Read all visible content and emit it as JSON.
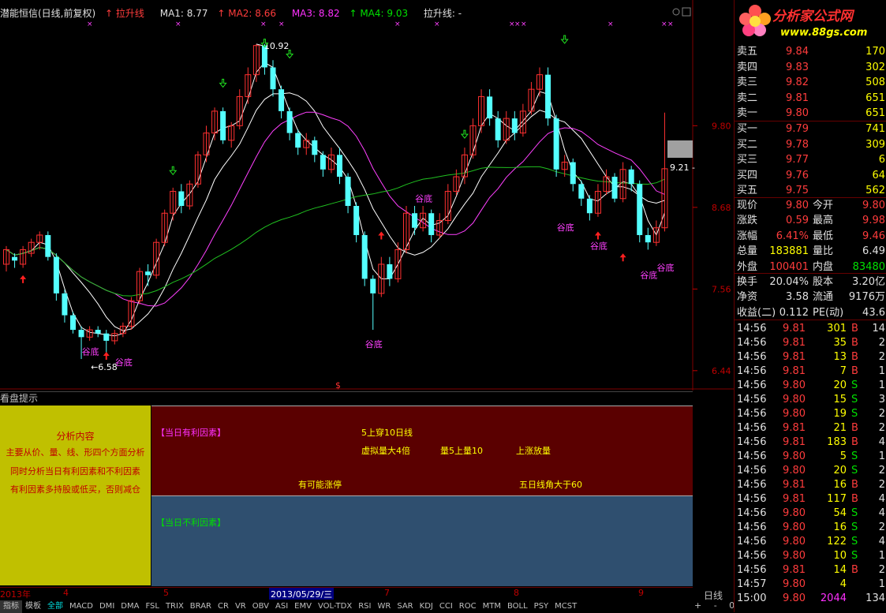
{
  "chart_title": {
    "name": "潜能恒信(日线,前复权)",
    "indicator": "拉升线",
    "ma1": "MA1: 8.77",
    "ma2": "MA2: 8.66",
    "ma3": "MA3: 8.82",
    "ma4": "MA4: 9.03",
    "line": "拉升线: -"
  },
  "price_axis": [
    "9.80",
    "8.68",
    "7.56",
    "6.44"
  ],
  "annotations": {
    "high": "10.92",
    "low": "6.58",
    "last": "9.21",
    "bottom_label": "谷底",
    "s_mark": "$"
  },
  "panel": {
    "title": "看盘提示",
    "left_lines": [
      "分析内容",
      "主要从价、量、线、形四个方面分析",
      "同时分析当日有利因素和不利因素",
      "有利因素多持股或低买，否则减仓"
    ],
    "good_header": "【当日有利因素】",
    "good_items": [
      "5上穿10日线",
      "虚拟量大4倍",
      "量5上量10",
      "上涨放量",
      "有可能涨停",
      "五日线角大于60"
    ],
    "bad_header": "【当日不利因素】"
  },
  "date_axis": {
    "labels": [
      "2013年",
      "4",
      "5",
      "2013/05/29/三",
      "7",
      "8",
      "9"
    ],
    "period": "日线"
  },
  "bottom_tabs": [
    "指标",
    "模板",
    "全部",
    "MACD",
    "DMI",
    "DMA",
    "FSL",
    "TRIX",
    "BRAR",
    "CR",
    "VR",
    "OBV",
    "ASI",
    "EMV",
    "VOL-TDX",
    "RSI",
    "WR",
    "SAR",
    "KDJ",
    "CCI",
    "ROC",
    "MTM",
    "BOLL",
    "PSY",
    "MCST"
  ],
  "bottom_right": "+ - 0",
  "logo": {
    "title": "分析家公式网",
    "url": "www.88gs.com"
  },
  "order_book": [
    {
      "label": "卖五",
      "price": "9.84",
      "vol": "170"
    },
    {
      "label": "卖四",
      "price": "9.83",
      "vol": "302"
    },
    {
      "label": "卖三",
      "price": "9.82",
      "vol": "508"
    },
    {
      "label": "卖二",
      "price": "9.81",
      "vol": "651"
    },
    {
      "label": "卖一",
      "price": "9.80",
      "vol": "651"
    },
    {
      "label": "买一",
      "price": "9.79",
      "vol": "741"
    },
    {
      "label": "买二",
      "price": "9.78",
      "vol": "309"
    },
    {
      "label": "买三",
      "price": "9.77",
      "vol": "6"
    },
    {
      "label": "买四",
      "price": "9.76",
      "vol": "64"
    },
    {
      "label": "买五",
      "price": "9.75",
      "vol": "562"
    }
  ],
  "quote": [
    {
      "l1": "现价",
      "v1": "9.80",
      "l2": "今开",
      "v2": "9.80"
    },
    {
      "l1": "涨跌",
      "v1": "0.59",
      "l2": "最高",
      "v2": "9.98"
    },
    {
      "l1": "涨幅",
      "v1": "6.41%",
      "l2": "最低",
      "v2": "9.46"
    },
    {
      "l1": "总量",
      "v1": "183881",
      "l2": "量比",
      "v2": "6.49"
    },
    {
      "l1": "外盘",
      "v1": "100401",
      "l2": "内盘",
      "v2": "83480"
    },
    {
      "l1": "换手",
      "v1": "20.04%",
      "l2": "股本",
      "v2": "3.20亿"
    },
    {
      "l1": "净资",
      "v1": "3.58",
      "l2": "流通",
      "v2": "9176万"
    },
    {
      "l1": "收益(二)",
      "v1": "0.112",
      "l2": "PE(动)",
      "v2": "43.6"
    }
  ],
  "ticks": [
    {
      "t": "14:56",
      "p": "9.81",
      "v": "301",
      "s": "B",
      "n": "14"
    },
    {
      "t": "14:56",
      "p": "9.81",
      "v": "35",
      "s": "B",
      "n": "2"
    },
    {
      "t": "14:56",
      "p": "9.81",
      "v": "13",
      "s": "B",
      "n": "2"
    },
    {
      "t": "14:56",
      "p": "9.81",
      "v": "7",
      "s": "B",
      "n": "1"
    },
    {
      "t": "14:56",
      "p": "9.80",
      "v": "20",
      "s": "S",
      "n": "1"
    },
    {
      "t": "14:56",
      "p": "9.80",
      "v": "15",
      "s": "S",
      "n": "3"
    },
    {
      "t": "14:56",
      "p": "9.80",
      "v": "19",
      "s": "S",
      "n": "2"
    },
    {
      "t": "14:56",
      "p": "9.81",
      "v": "21",
      "s": "B",
      "n": "2"
    },
    {
      "t": "14:56",
      "p": "9.81",
      "v": "183",
      "s": "B",
      "n": "4"
    },
    {
      "t": "14:56",
      "p": "9.80",
      "v": "5",
      "s": "S",
      "n": "1"
    },
    {
      "t": "14:56",
      "p": "9.80",
      "v": "20",
      "s": "S",
      "n": "2"
    },
    {
      "t": "14:56",
      "p": "9.81",
      "v": "16",
      "s": "B",
      "n": "2"
    },
    {
      "t": "14:56",
      "p": "9.81",
      "v": "117",
      "s": "B",
      "n": "4"
    },
    {
      "t": "14:56",
      "p": "9.80",
      "v": "54",
      "s": "S",
      "n": "4"
    },
    {
      "t": "14:56",
      "p": "9.80",
      "v": "16",
      "s": "S",
      "n": "2"
    },
    {
      "t": "14:56",
      "p": "9.80",
      "v": "122",
      "s": "S",
      "n": "4"
    },
    {
      "t": "14:56",
      "p": "9.80",
      "v": "10",
      "s": "S",
      "n": "1"
    },
    {
      "t": "14:56",
      "p": "9.81",
      "v": "14",
      "s": "B",
      "n": "2"
    },
    {
      "t": "14:57",
      "p": "9.80",
      "v": "4",
      "s": "",
      "n": "1"
    },
    {
      "t": "15:00",
      "p": "9.80",
      "v": "2044",
      "s": "",
      "n": "134"
    }
  ],
  "chart_data": {
    "type": "candlestick",
    "ylim": [
      6.2,
      11.2
    ],
    "ticks": [
      9.8,
      8.68,
      7.56,
      6.44
    ],
    "candles": [
      [
        7.9,
        8.1,
        7.8,
        8.15
      ],
      [
        8.0,
        7.95,
        7.85,
        8.05
      ],
      [
        7.9,
        8.1,
        7.85,
        8.15
      ],
      [
        8.05,
        8.2,
        8.0,
        8.25
      ],
      [
        8.2,
        8.3,
        8.1,
        8.35
      ],
      [
        8.3,
        8.0,
        7.95,
        8.35
      ],
      [
        8.0,
        7.5,
        7.4,
        8.05
      ],
      [
        7.5,
        7.2,
        7.1,
        7.55
      ],
      [
        7.2,
        7.0,
        6.95,
        7.25
      ],
      [
        7.0,
        6.9,
        6.6,
        7.05
      ],
      [
        6.9,
        7.0,
        6.85,
        7.05
      ],
      [
        7.0,
        6.95,
        6.9,
        7.05
      ],
      [
        6.95,
        6.85,
        6.6,
        7.0
      ],
      [
        6.85,
        6.95,
        6.8,
        7.0
      ],
      [
        6.95,
        7.05,
        6.9,
        7.1
      ],
      [
        7.05,
        7.4,
        7.0,
        7.45
      ],
      [
        7.4,
        7.8,
        7.35,
        7.85
      ],
      [
        7.8,
        7.75,
        7.6,
        7.9
      ],
      [
        7.75,
        8.2,
        7.7,
        8.25
      ],
      [
        8.2,
        8.6,
        8.15,
        8.65
      ],
      [
        8.6,
        8.9,
        8.5,
        8.95
      ],
      [
        8.9,
        8.7,
        8.6,
        9.0
      ],
      [
        8.7,
        9.0,
        8.65,
        9.05
      ],
      [
        9.0,
        9.4,
        8.95,
        9.45
      ],
      [
        9.4,
        9.7,
        9.3,
        9.8
      ],
      [
        9.7,
        10.0,
        9.6,
        10.05
      ],
      [
        10.0,
        9.6,
        9.55,
        10.05
      ],
      [
        9.6,
        9.8,
        9.5,
        9.85
      ],
      [
        9.8,
        10.2,
        9.75,
        10.3
      ],
      [
        10.2,
        10.5,
        10.1,
        10.6
      ],
      [
        10.5,
        10.9,
        10.4,
        10.92
      ],
      [
        10.9,
        10.6,
        10.5,
        10.92
      ],
      [
        10.6,
        10.3,
        10.2,
        10.7
      ],
      [
        10.3,
        10.0,
        9.9,
        10.35
      ],
      [
        10.0,
        9.7,
        9.6,
        10.05
      ],
      [
        9.7,
        9.5,
        9.4,
        9.75
      ],
      [
        9.5,
        9.6,
        9.4,
        9.7
      ],
      [
        9.6,
        9.4,
        9.3,
        9.65
      ],
      [
        9.4,
        9.2,
        9.1,
        9.45
      ],
      [
        9.2,
        9.4,
        9.15,
        9.5
      ],
      [
        9.4,
        9.1,
        9.0,
        9.5
      ],
      [
        9.1,
        8.7,
        8.6,
        9.15
      ],
      [
        8.7,
        8.3,
        8.2,
        8.75
      ],
      [
        8.3,
        7.7,
        7.6,
        8.35
      ],
      [
        7.7,
        7.5,
        7.0,
        7.75
      ],
      [
        7.5,
        7.9,
        7.45,
        8.0
      ],
      [
        7.9,
        7.7,
        7.6,
        8.0
      ],
      [
        7.7,
        8.1,
        7.65,
        8.2
      ],
      [
        8.1,
        8.6,
        8.05,
        8.7
      ],
      [
        8.6,
        8.4,
        8.3,
        8.7
      ],
      [
        8.4,
        8.6,
        8.35,
        8.7
      ],
      [
        8.6,
        8.3,
        8.2,
        8.65
      ],
      [
        8.3,
        8.5,
        8.25,
        8.6
      ],
      [
        8.5,
        8.9,
        8.45,
        9.0
      ],
      [
        8.9,
        9.1,
        8.85,
        9.2
      ],
      [
        9.1,
        9.4,
        9.0,
        9.5
      ],
      [
        9.4,
        9.8,
        9.35,
        9.9
      ],
      [
        9.8,
        10.2,
        9.7,
        10.3
      ],
      [
        10.2,
        9.9,
        9.8,
        10.3
      ],
      [
        9.9,
        9.6,
        9.5,
        10.0
      ],
      [
        9.6,
        9.9,
        9.55,
        10.0
      ],
      [
        9.9,
        9.7,
        9.6,
        10.0
      ],
      [
        9.7,
        10.0,
        9.65,
        10.1
      ],
      [
        10.0,
        10.3,
        9.95,
        10.4
      ],
      [
        10.3,
        10.5,
        10.2,
        10.6
      ],
      [
        10.5,
        9.9,
        9.8,
        10.6
      ],
      [
        9.9,
        9.2,
        9.1,
        9.95
      ],
      [
        9.2,
        9.3,
        9.1,
        9.4
      ],
      [
        9.3,
        9.0,
        8.9,
        9.35
      ],
      [
        9.0,
        8.8,
        8.7,
        9.05
      ],
      [
        8.8,
        8.6,
        8.5,
        8.85
      ],
      [
        8.6,
        8.9,
        8.55,
        9.0
      ],
      [
        8.9,
        9.1,
        8.85,
        9.2
      ],
      [
        9.1,
        8.8,
        8.75,
        9.15
      ],
      [
        8.8,
        9.2,
        8.75,
        9.3
      ],
      [
        9.2,
        9.0,
        8.9,
        9.25
      ],
      [
        9.0,
        8.3,
        8.2,
        9.05
      ],
      [
        8.3,
        8.2,
        8.1,
        8.4
      ],
      [
        8.2,
        8.4,
        8.15,
        8.5
      ],
      [
        8.4,
        9.21,
        8.35,
        9.98
      ]
    ],
    "s_mark": "$"
  }
}
